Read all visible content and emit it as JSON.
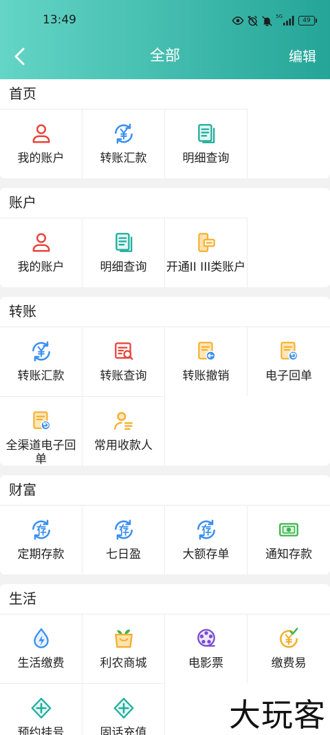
{
  "status_bar": {
    "time": "13:49",
    "network": "5G",
    "battery": "49"
  },
  "header": {
    "title": "全部",
    "edit_label": "编辑"
  },
  "sections": [
    {
      "title": "首页",
      "items": [
        {
          "label": "我的账户",
          "icon": "person-icon"
        },
        {
          "label": "转账汇款",
          "icon": "transfer-icon"
        },
        {
          "label": "明细查询",
          "icon": "detail-icon"
        }
      ]
    },
    {
      "title": "账户",
      "items": [
        {
          "label": "我的账户",
          "icon": "person-icon"
        },
        {
          "label": "明细查询",
          "icon": "detail-icon"
        },
        {
          "label": "开通II III类账户",
          "icon": "card-icon"
        }
      ]
    },
    {
      "title": "转账",
      "items": [
        {
          "label": "转账汇款",
          "icon": "transfer-icon"
        },
        {
          "label": "转账查询",
          "icon": "transfer-query-icon"
        },
        {
          "label": "转账撤销",
          "icon": "transfer-revoke-icon"
        },
        {
          "label": "电子回单",
          "icon": "receipt-icon"
        },
        {
          "label": "全渠道电子回单",
          "icon": "receipt-icon"
        },
        {
          "label": "常用收款人",
          "icon": "payee-icon"
        }
      ]
    },
    {
      "title": "财富",
      "items": [
        {
          "label": "定期存款",
          "icon": "deposit-icon"
        },
        {
          "label": "七日盈",
          "icon": "deposit-icon"
        },
        {
          "label": "大额存单",
          "icon": "deposit-icon"
        },
        {
          "label": "通知存款",
          "icon": "cash-icon"
        }
      ]
    },
    {
      "title": "生活",
      "items": [
        {
          "label": "生活缴费",
          "icon": "water-icon"
        },
        {
          "label": "利农商城",
          "icon": "shop-bag-icon"
        },
        {
          "label": "电影票",
          "icon": "film-icon"
        },
        {
          "label": "缴费易",
          "icon": "pay-easy-icon"
        },
        {
          "label": "预约挂号",
          "icon": "plus-icon"
        },
        {
          "label": "固话充值",
          "icon": "plus-icon"
        }
      ]
    }
  ],
  "watermark": "大玩客",
  "colors": {
    "header_gradient_start": "#64d5c6",
    "header_gradient_end": "#24a598",
    "page_background": "#f2f2f2",
    "red": "#e8453c",
    "blue": "#3b8ff0",
    "teal": "#1fae9c",
    "orange": "#f6ae2d",
    "green": "#3bb54a",
    "purple": "#7a4bd3"
  }
}
